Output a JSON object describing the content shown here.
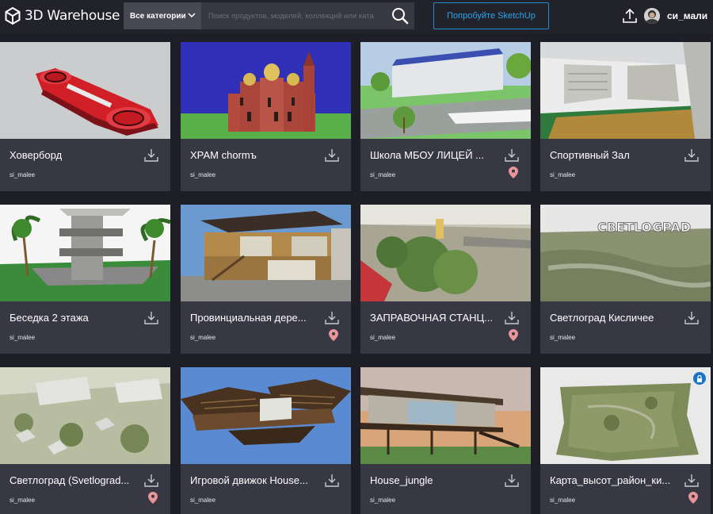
{
  "header": {
    "logo_text": "3D Warehouse",
    "category_select": "Все категории",
    "search_placeholder": "Поиск продуктов, моделей, коллекций или ката",
    "try_button": "Попробуйте SketchUp",
    "username": "си_мали"
  },
  "colors": {
    "accent": "#1e90d0",
    "pin": "#e9969a",
    "card_bg": "#383845",
    "page_bg": "#1e1e26"
  },
  "models": [
    {
      "title": "Ховерборд",
      "author": "si_malee",
      "geolocated": false,
      "locked": false
    },
    {
      "title": "ХРАМ chormъ",
      "author": "si_malee",
      "geolocated": false,
      "locked": false
    },
    {
      "title": "Школа МБОУ ЛИЦЕЙ ...",
      "author": "si_malee",
      "geolocated": true,
      "locked": false
    },
    {
      "title": "Спортивный Зал",
      "author": "si_malee",
      "geolocated": false,
      "locked": false
    },
    {
      "title": "Беседка 2 этажа",
      "author": "si_malee",
      "geolocated": false,
      "locked": false
    },
    {
      "title": "Провинциальная дере...",
      "author": "si_malee",
      "geolocated": true,
      "locked": false
    },
    {
      "title": "ЗАПРАВОЧНАЯ СТАНЦ...",
      "author": "si_malee",
      "geolocated": true,
      "locked": false
    },
    {
      "title": "Светлоград Кисличее",
      "author": "si_malee",
      "geolocated": false,
      "locked": false
    },
    {
      "title": "Светлоград (Svetlograd...",
      "author": "si_malee",
      "geolocated": true,
      "locked": false
    },
    {
      "title": "Игровой движок House...",
      "author": "si_malee",
      "geolocated": false,
      "locked": false
    },
    {
      "title": "House_jungle",
      "author": "si_malee",
      "geolocated": false,
      "locked": false
    },
    {
      "title": "Карта_высот_район_ки...",
      "author": "si_malee",
      "geolocated": true,
      "locked": true
    }
  ],
  "thumbnail_text": {
    "svetlograd_sign": "CBETLOGPAD"
  }
}
